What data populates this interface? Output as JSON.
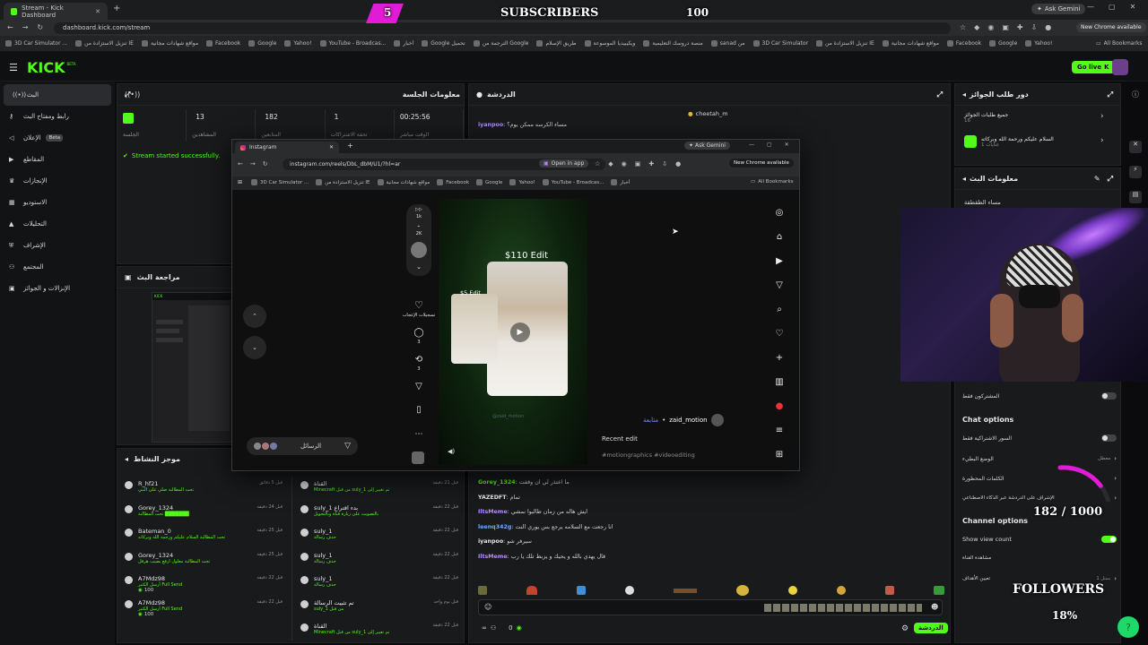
{
  "browser": {
    "tabs": [
      {
        "title": "Stream - Kick Dashboard"
      }
    ],
    "url": "dashboard.kick.com/stream",
    "ask_gemini": "Ask Gemini",
    "new_chrome": "New Chrome available",
    "bookmarks": [
      "3D Car Simulator ...",
      "تنزيل الاستزادة من IE",
      "مواقع شهادات مجانية",
      "Facebook",
      "Google",
      "Yahoo!",
      "YouTube - Broadcas...",
      "أخبار",
      "Google تحميل",
      "الترجمة من Google",
      "طريق الإسلام",
      "ويكيبيديا الموسوعة",
      "منصة دروسك التعليمية",
      "sanad من",
      "3D Car Simulator",
      "تنزيل الاستزادة من IE",
      "مواقع شهادات مجانية",
      "Facebook",
      "Google",
      "Yahoo!"
    ],
    "all_bookmarks": "All Bookmarks"
  },
  "kick": {
    "logo": "KICK",
    "logo_badge": "BETA",
    "go_live": "Go live",
    "nav": [
      {
        "label": "البث",
        "icon": "radio-icon",
        "active": true
      },
      {
        "label": "رابط ومفتاح البث",
        "icon": "key-icon"
      },
      {
        "label": "الإعلان",
        "badge": "Beta",
        "icon": "megaphone-icon"
      },
      {
        "label": "المقاطع",
        "icon": "clip-icon"
      },
      {
        "label": "الإنجازات",
        "icon": "trophy-icon"
      },
      {
        "label": "الاستوديو",
        "icon": "studio-icon"
      },
      {
        "label": "التحليلات",
        "icon": "chart-icon"
      },
      {
        "label": "الإشراف",
        "icon": "shield-icon"
      },
      {
        "label": "المجتمع",
        "icon": "people-icon"
      },
      {
        "label": "الإنزالات و الجوائز",
        "icon": "gift-icon"
      }
    ]
  },
  "session": {
    "title": "معلومات الجلسة",
    "stats": [
      {
        "value": "",
        "label": "الجلسة"
      },
      {
        "value": "13",
        "label": "المشاهدين"
      },
      {
        "value": "182",
        "label": "المتابعين"
      },
      {
        "value": "1",
        "label": "تحفة الاشتراكات"
      },
      {
        "value": "00:25:56",
        "label": "الوقت مباشر"
      }
    ],
    "success": "Stream started successfully."
  },
  "preview": {
    "title": "مراجعة البث"
  },
  "activity": {
    "title": "موجز النشاط",
    "left": [
      {
        "name": "R_hf21",
        "desc": "تحت المطالبة صلي على النبي",
        "time": "قبل 5 دقائق"
      },
      {
        "name": "Gorey_1324",
        "desc": "تحت المطالبة ███████",
        "time": "قبل 24 دقيقة"
      },
      {
        "name": "Bateman_0",
        "desc": "تحت المطالبة السلام عليكم ورحمة الله وبركاته",
        "time": "قبل 25 دقيقة"
      },
      {
        "name": "Gorey_1324",
        "desc": "تحت المطالبة معلول ارفع يصيب هرقل",
        "time": "قبل 25 دقيقة"
      },
      {
        "name": "A7Mdz98",
        "desc": "أرسل الكثير Full Send",
        "points": "100",
        "time": "قبل 22 دقيقة"
      },
      {
        "name": "A7Mdz98",
        "desc": "أرسل الكثير Full Send",
        "points": "100",
        "time": "قبل 22 دقيقة"
      }
    ],
    "right": [
      {
        "name": "القناة",
        "desc": "Minecraft من قبل suly_1 تم تغيير إلى",
        "time": "قبل 21 دقيقة"
      },
      {
        "name": "suly_1 بدء اقتراع",
        "desc": "بالتصويت على زيارة قناة وبالتحويل",
        "time": "قبل 22 دقيقة"
      },
      {
        "name": "suly_1",
        "desc": "حذف رسالة",
        "time": "قبل 22 دقيقة"
      },
      {
        "name": "suly_1",
        "desc": "حذف رسالة",
        "time": "قبل 22 دقيقة"
      },
      {
        "name": "suly_1",
        "desc": "حذف رسالة",
        "time": "قبل 22 دقيقة"
      },
      {
        "name": "تم تثبيت الرسالة",
        "desc": "suly_1 من قبل",
        "time": "قبل يوم واحد"
      },
      {
        "name": "القناة",
        "desc": "Minecraft من قبل suly_1 تم تغيير إلى",
        "time": "قبل 22 دقيقة"
      }
    ]
  },
  "chat": {
    "title": "الدردشة",
    "pinned": "cheetah_m",
    "top_line": {
      "user": "iyanpoo",
      "text": "مساء الكرسه ممكن يوم؟"
    },
    "lines": [
      {
        "user": "Gorey_1324",
        "text": "ما اعتذر لي ان وقفت"
      },
      {
        "user": "YAZEDFT",
        "text": "تمام"
      },
      {
        "user": "IltsMeme",
        "text": "ايش هاله من زمان طالبوا نمشي"
      },
      {
        "user": "leenq342g",
        "text": "انا رجعت مع السلامه يرجع بس يوري النت"
      },
      {
        "user": "iyanpoo",
        "text": "سيرفر شو"
      },
      {
        "user": "IltsMeme",
        "text": "قال يهدي بالله و يحيك و يزبط تلك يا رب"
      }
    ],
    "send": "الدردشة",
    "footer_count": "0"
  },
  "rewards": {
    "title": "دور طلب الجوائز",
    "items": [
      {
        "title": "جميع طلبات الجوائز",
        "sub": "16"
      },
      {
        "title": "السلام عليكم ورحمة الله وبركاته",
        "sub": "عنايات 1"
      }
    ]
  },
  "stream_info": {
    "title": "معلومات البث",
    "stream_title": "مساء الطقطقة"
  },
  "settings": {
    "subscribers_only": "المشتركون فقط",
    "chat_options": "Chat options",
    "followers_only": "السور الاشتراكية فقط",
    "slow_mode": "الوضع البطيء",
    "slow_value": "معطل",
    "blocked_words": "الكلمات المحظورة",
    "ai_moderation": "الإشراف على الدردشة عبر الذكاء الاصطناعي",
    "channel_options": "Channel options",
    "show_view_count": "Show view count",
    "channel_mode": "مشاهدة القناة",
    "goal": "تعيين الأهداف",
    "goal_value": "ممثل 1"
  },
  "instagram": {
    "tab": "Instagram",
    "url": "instagram.com/reels/DbL_dbM/U1/?hl=ar",
    "open_in_app": "Open in app",
    "ask_gemini": "Ask Gemini",
    "new_chrome": "New Chrome available",
    "bookmarks": [
      "3D Car Simulator ...",
      "تنزيل الاستزادة من IE",
      "مواقع شهادات مجانية",
      "Facebook",
      "Google",
      "Yahoo!",
      "YouTube - Broadcas...",
      "أخبار"
    ],
    "all_bookmarks": "All Bookmarks",
    "video_big": "$110 Edit",
    "video_small": "$5 Edit",
    "watermark": "@zaid_motion",
    "likes_label": "تسجيلات الإعجاب",
    "comments": "3",
    "reposts": "3",
    "user": "zaid_motion",
    "follow": "متابعة",
    "caption": "Recent edit",
    "tags": "#motiongraphics #videoediting",
    "messages": "الرسائل",
    "rail_count_1": "1k",
    "rail_count_2": "2K"
  },
  "overlay": {
    "subscribers_label": "SUBSCRIBERS",
    "subscribers_current": "5",
    "subscribers_goal": "100",
    "followers_count": "182 / 1000",
    "followers_label": "FOLLOWERS",
    "followers_percent": "18%",
    "followers_progress": 0.18
  },
  "colors": {
    "brand": "#53fc18",
    "pink": "#e11bd6",
    "panel": "#181a1c"
  }
}
